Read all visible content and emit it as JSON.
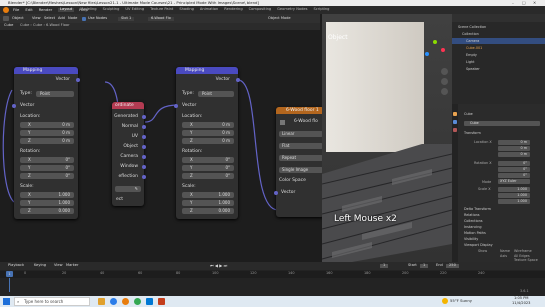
{
  "window": {
    "title": "Blender* [C:\\Blender\\Meshes\\Lesson\\New files\\Lesson21.1 - Ultimate Mode Courses\\21 - Principled Mode With Images\\Scene\\ blend]"
  },
  "menu": {
    "items": [
      "File",
      "Edit",
      "Render",
      "Window",
      "Help"
    ],
    "workspaces": [
      "Layout",
      "Modeling",
      "Sculpting",
      "UV Editing",
      "Texture Paint",
      "Shading",
      "Animation",
      "Rendering",
      "Compositing",
      "Geometry Nodes",
      "Scripting"
    ]
  },
  "node_header": {
    "editor": "Object",
    "menus": [
      "View",
      "Select",
      "Add",
      "Node"
    ],
    "use_nodes": "Use Nodes",
    "slot": "Slot 1",
    "material": "6-Wood Flo",
    "viewport_mode": "Object Mode"
  },
  "node_header2": {
    "object": "Cube",
    "breadcrumb": [
      "Cube",
      "Cube",
      "6-Wood Floor"
    ]
  },
  "mapping1": {
    "title": "Mapping",
    "vector_out": "Vector",
    "type_label": "Type:",
    "type_value": "Point",
    "vector_in": "Vector",
    "location": "Location:",
    "rotation": "Rotation:",
    "scale": "Scale:",
    "x": "X",
    "y": "Y",
    "z": "Z",
    "loc": [
      "0 m",
      "0 m",
      "0 m"
    ],
    "rot": [
      "0°",
      "0°",
      "0°"
    ],
    "scl": [
      "1.000",
      "1.000",
      "0.000"
    ]
  },
  "texcoord": {
    "items": [
      "ordinate",
      "Generated",
      "Normal",
      "UV",
      "Object",
      "Camera",
      "Window",
      "eflection",
      "ect"
    ]
  },
  "mapping2": {
    "title": "Mapping",
    "vector_out": "Vector",
    "type_label": "Type:",
    "type_value": "Point",
    "vector_in": "Vector",
    "location": "Location:",
    "rotation": "Rotation:",
    "scale": "Scale:",
    "x": "X",
    "y": "Y",
    "z": "Z",
    "loc": [
      "0 m",
      "0 m",
      "0 m"
    ],
    "rot": [
      "0°",
      "0°",
      "0°"
    ],
    "scl": [
      "1.000",
      "1.000",
      "0.000"
    ]
  },
  "imgtex": {
    "title": "6-Wood floor 1",
    "image_name": "6-Wood flo",
    "interpolation": "Linear",
    "projection": "Flat",
    "extension": "Repeat",
    "source": "Single Image",
    "colorspace": "Color Space",
    "vector": "Vector"
  },
  "viewport": {
    "hint": "Left Mouse x2",
    "mode": "Object"
  },
  "outliner": {
    "title": "Scene Collection",
    "items": [
      "Collection",
      "Camera",
      "Cube.001",
      "Empty",
      "Light",
      "Speaker"
    ]
  },
  "properties": {
    "object": "Cube",
    "name": "Cube",
    "section": "Transform",
    "loc_label": "Location X",
    "rot_label": "Rotation X",
    "mode_label": "Mode",
    "mode_value": "XYZ Euler",
    "scale_label": "Scale X",
    "loc": [
      "0 m",
      "0 m",
      "0 m"
    ],
    "rot": [
      "0°",
      "0°",
      "0°"
    ],
    "scl": [
      "1.000",
      "1.000",
      "1.000"
    ],
    "sections": [
      "Delta Transform",
      "Relations",
      "Collections",
      "Instancing",
      "Motion Paths",
      "Visibility",
      "Viewport Display"
    ],
    "vd_show": "Show",
    "vd_items": [
      "Name",
      "Axis",
      "Wireframe",
      "All Edges",
      "Texture Space"
    ]
  },
  "timeline": {
    "menus": [
      "Playback",
      "Keying",
      "View",
      "Marker"
    ],
    "start_label": "Start",
    "start": "1",
    "end_label": "End",
    "end": "250",
    "frame": "1",
    "ticks": [
      "0",
      "20",
      "40",
      "60",
      "80",
      "100",
      "120",
      "140",
      "160",
      "180",
      "200",
      "220",
      "240"
    ],
    "status": "3.6.1"
  },
  "taskbar": {
    "search": "Type here to search",
    "weather": "55°F Sunny",
    "time": "1:05 PM",
    "date": "11/4/2023"
  }
}
